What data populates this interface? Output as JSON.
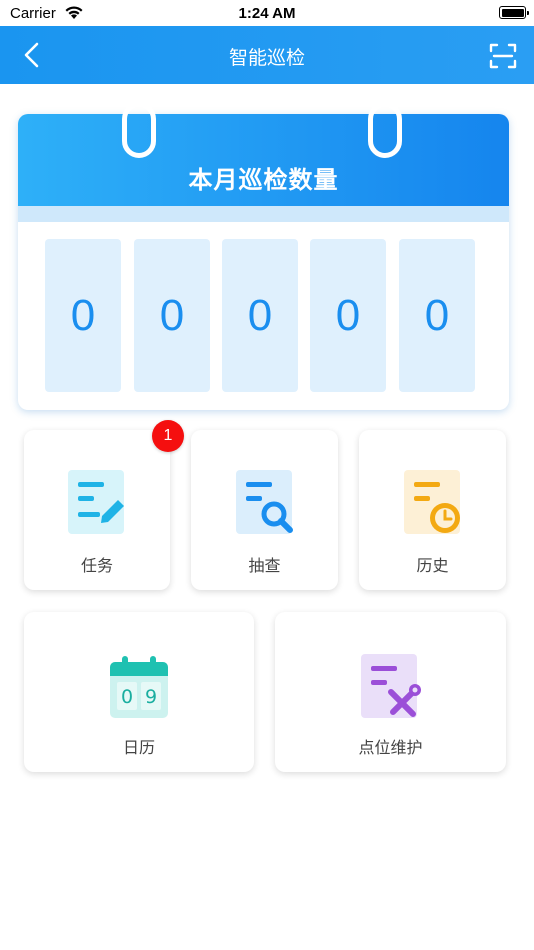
{
  "status_bar": {
    "carrier": "Carrier",
    "time": "1:24 AM"
  },
  "nav": {
    "title": "智能巡检",
    "back_icon": "chevron-left-icon",
    "scan_icon": "scan-icon"
  },
  "calendar_card": {
    "title": "本月巡检数量",
    "digits": [
      "0",
      "0",
      "0",
      "0",
      "0"
    ]
  },
  "menu": {
    "task": {
      "label": "任务",
      "badge": "1",
      "icon": "task-edit-icon"
    },
    "spot_check": {
      "label": "抽查",
      "icon": "search-document-icon"
    },
    "history": {
      "label": "历史",
      "icon": "history-clock-icon"
    },
    "calendar": {
      "label": "日历",
      "icon": "calendar-icon",
      "icon_digits": [
        "0",
        "9"
      ]
    },
    "point_maintenance": {
      "label": "点位维护",
      "icon": "maintenance-tools-icon"
    }
  },
  "colors": {
    "nav_bar": "#1a95f0",
    "accent": "#1585ee",
    "digit_bg": "#dff0fd",
    "badge": "#f50f0f"
  }
}
